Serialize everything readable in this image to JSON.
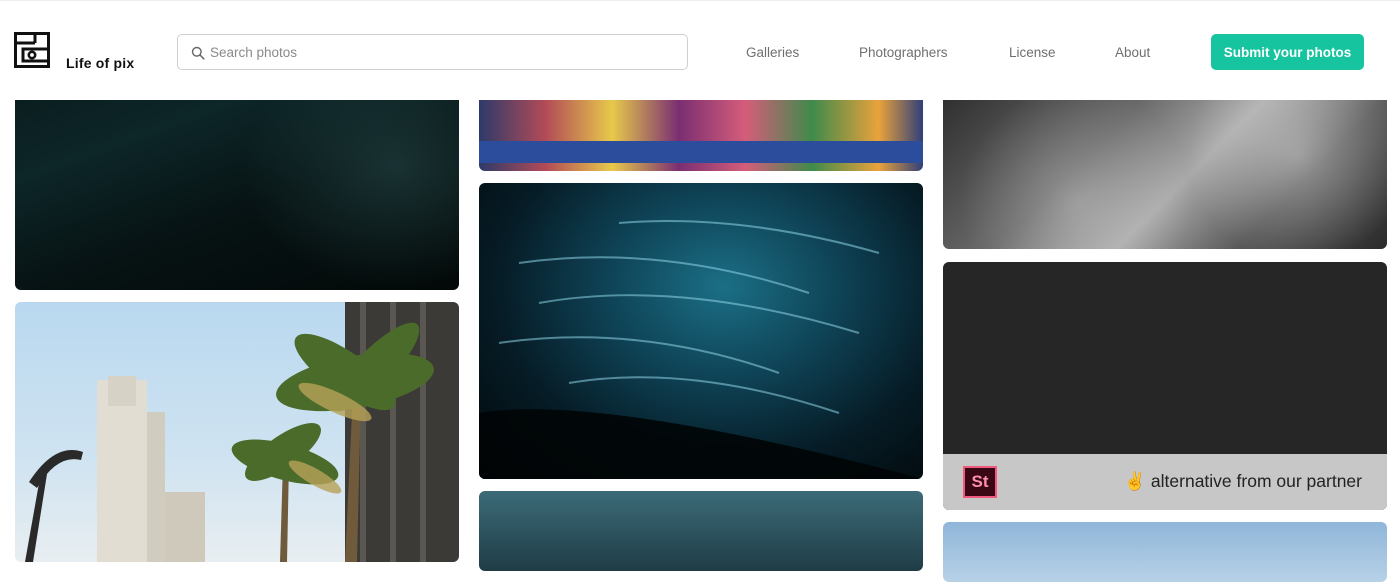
{
  "brand": {
    "name": "Life of pix",
    "accent": "#16c49f"
  },
  "search": {
    "placeholder": "Search photos",
    "value": ""
  },
  "nav": [
    {
      "label": "Galleries"
    },
    {
      "label": "Photographers"
    },
    {
      "label": "License"
    },
    {
      "label": "About"
    }
  ],
  "cta": {
    "label": "Submit your photos"
  },
  "ad": {
    "logo_text": "St",
    "text": "alternative from our partner",
    "emoji": "✌"
  },
  "icons": {
    "search": "search-icon",
    "logo": "logo-icon"
  }
}
